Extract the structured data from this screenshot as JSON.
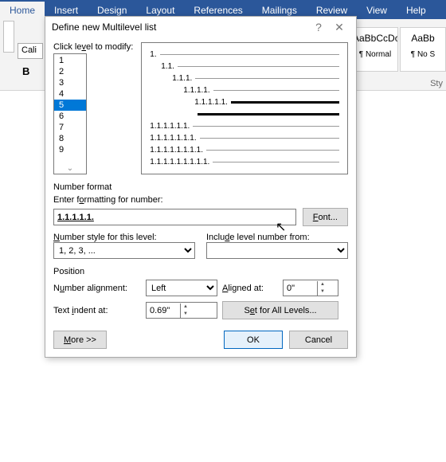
{
  "ribbon": {
    "tabs": [
      "Home",
      "Insert",
      "Design",
      "Layout",
      "References",
      "Mailings",
      "Review",
      "View",
      "Help"
    ],
    "active_tab": "Home",
    "font_box": "Cali",
    "bold": "B",
    "styles": [
      {
        "preview": "AaBbCcDc",
        "name": "¶ Normal"
      },
      {
        "preview": "AaBb",
        "name": "¶ No S"
      }
    ],
    "styles_label": "Sty"
  },
  "dialog": {
    "title": "Define new Multilevel list",
    "help": "?",
    "close": "✕",
    "click_level_label": "Click level to modify:",
    "levels": [
      "1",
      "2",
      "3",
      "4",
      "5",
      "6",
      "7",
      "8",
      "9"
    ],
    "selected_level_index": 4,
    "preview": [
      {
        "indent": 0,
        "num": "1.",
        "bold": false
      },
      {
        "indent": 1,
        "num": "1.1.",
        "bold": false
      },
      {
        "indent": 2,
        "num": "1.1.1.",
        "bold": false
      },
      {
        "indent": 3,
        "num": "1.1.1.1.",
        "bold": false
      },
      {
        "indent": 4,
        "num": "1.1.1.1.1.",
        "bold": true
      },
      {
        "indent": 4,
        "num": "",
        "bold": true
      },
      {
        "indent": 0,
        "num": "1.1.1.1.1.1.",
        "bold": false
      },
      {
        "indent": 0,
        "num": "1.1.1.1.1.1.1.",
        "bold": false
      },
      {
        "indent": 0,
        "num": "1.1.1.1.1.1.1.1.",
        "bold": false
      },
      {
        "indent": 0,
        "num": "1.1.1.1.1.1.1.1.1.",
        "bold": false
      }
    ],
    "number_format_label": "Number format",
    "enter_formatting_label": "Enter formatting for number:",
    "formatting_value": "1.1.1.1.1.",
    "font_button": "Font...",
    "number_style_label": "Number style for this level:",
    "number_style_value": "1, 2, 3, ...",
    "include_level_label": "Include level number from:",
    "include_level_value": "",
    "position_label": "Position",
    "number_alignment_label": "Number alignment:",
    "number_alignment_value": "Left",
    "aligned_at_label": "Aligned at:",
    "aligned_at_value": "0\"",
    "text_indent_label": "Text indent at:",
    "text_indent_value": "0.69\"",
    "set_for_all_button": "Set for All Levels...",
    "more_button": "More >>",
    "ok_button": "OK",
    "cancel_button": "Cancel"
  }
}
